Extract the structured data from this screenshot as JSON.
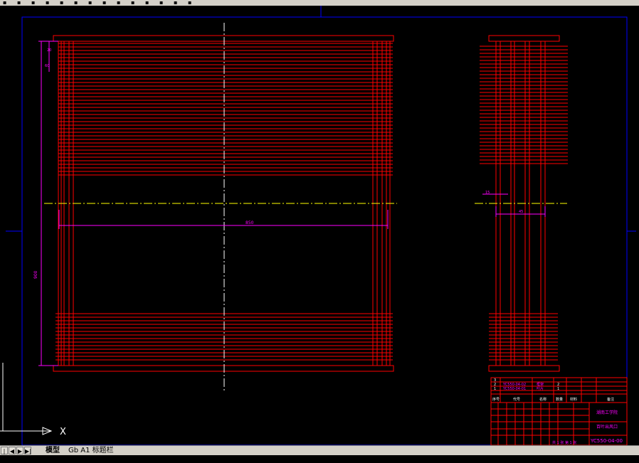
{
  "toolbar": {
    "icons": [
      "new-icon",
      "open-icon",
      "save-icon",
      "print-icon",
      "undo-icon",
      "redo-icon",
      "pan-icon",
      "zoom-icon",
      "zoom-window-icon",
      "zoom-previous-icon",
      "properties-icon",
      "design-center-icon",
      "tool-palettes-icon",
      "help-icon"
    ]
  },
  "drawing": {
    "background_color": "#000000",
    "line_color": "#ff0000",
    "center_line_color": "#ffff00",
    "vertical_center_color": "#ffffff",
    "dimension_color": "#ff00ff",
    "frame_color": "#0000ff",
    "dimensions": {
      "width_label": "850",
      "height_label": "900",
      "top_small_1": "20",
      "top_small_2": "60",
      "side_small": "15",
      "side_width": "45"
    }
  },
  "title_block": {
    "parts": [
      {
        "no": "3",
        "code": "",
        "name": "",
        "qty": "",
        "material": ""
      },
      {
        "no": "2",
        "code": "YC550-04-02",
        "name": "框架",
        "qty": "2",
        "material": ""
      },
      {
        "no": "1",
        "code": "YC550-04-01",
        "name": "叶片",
        "qty": "1",
        "material": ""
      }
    ],
    "header": {
      "no": "序号",
      "code": "代号",
      "name": "名称",
      "qty": "数量",
      "material": "材料",
      "note": "备注"
    },
    "company": "湖南工学院",
    "drawing_name": "百叶出风口",
    "drawing_number": "YC550-04-00",
    "sheet": "共 1 张 第 1 张"
  },
  "status": {
    "nav_buttons": [
      "|◀",
      "◀",
      "▶",
      "▶|"
    ],
    "tabs": [
      "模型",
      "Gb A1 标题栏"
    ],
    "active_tab": "模型",
    "axis_label": "X"
  }
}
